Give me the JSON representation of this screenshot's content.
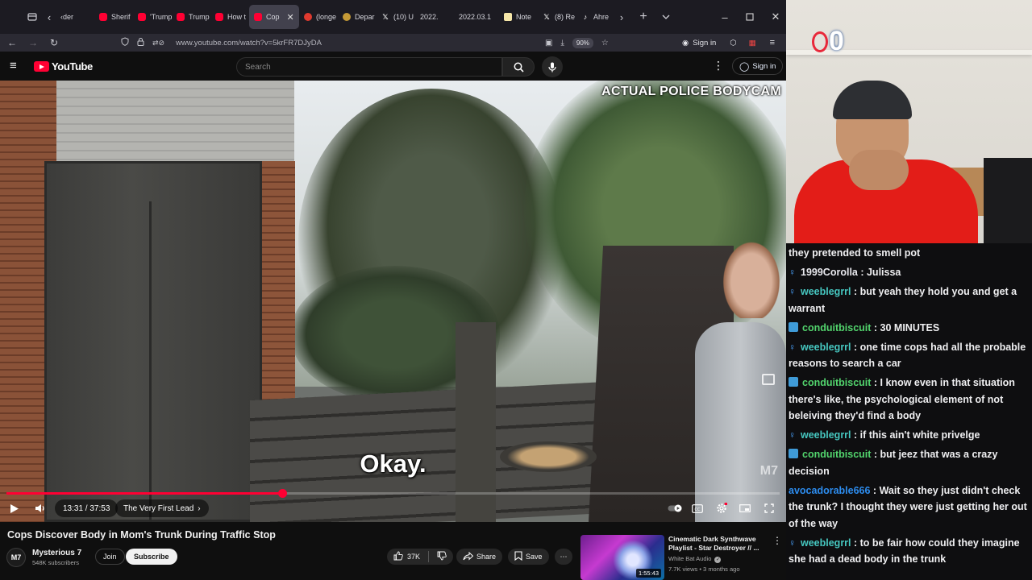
{
  "browser": {
    "tabs": [
      {
        "label": "‹der",
        "icon": "none"
      },
      {
        "label": "Sherif",
        "icon": "youtube"
      },
      {
        "label": "'Trump",
        "icon": "youtube"
      },
      {
        "label": "Trump",
        "icon": "youtube"
      },
      {
        "label": "How t",
        "icon": "youtube"
      },
      {
        "label": "Cop",
        "icon": "youtube",
        "active": true
      },
      {
        "label": "(longe",
        "icon": "red"
      },
      {
        "label": "Depar",
        "icon": "gold"
      },
      {
        "label": "(10) U",
        "icon": "x"
      },
      {
        "label": "2022.",
        "icon": "none"
      },
      {
        "label": "2022.03.1",
        "icon": "none"
      },
      {
        "label": "Note",
        "icon": "note"
      },
      {
        "label": "(8) Re",
        "icon": "x"
      },
      {
        "label": "Ahre",
        "icon": "tiktok"
      }
    ],
    "url": "www.youtube.com/watch?v=5krFR7DJyDA",
    "zoom": "90%",
    "signin_label": "Sign in"
  },
  "youtube": {
    "logo_text": "YouTube",
    "search_placeholder": "Search",
    "signin_label": "Sign in",
    "video": {
      "overlay_label": "ACTUAL POLICE BODYCAM",
      "caption": "Okay.",
      "watermark": "M7",
      "time_current": "13:31",
      "time_total": "37:53",
      "time_display": "13:31 / 37:53",
      "progress": 0.357,
      "chapter": "The Very First Lead"
    },
    "title": "Cops Discover Body in Mom's Trunk During Traffic Stop",
    "channel": {
      "name": "Mysterious 7",
      "subscribers": "548K subscribers",
      "avatar_text": "M7",
      "join_label": "Join",
      "subscribe_label": "Subscribe"
    },
    "actions": {
      "likes": "37K",
      "share_label": "Share",
      "save_label": "Save"
    },
    "recommendation": {
      "title": "Cinematic Dark Synthwave Playlist - Star Destroyer // ...",
      "channel": "White Bat Audio",
      "meta": "7.7K views • 3 months ago",
      "duration": "1:55:43"
    }
  },
  "stream": {
    "overlay_count": "0",
    "chat": [
      {
        "user": "",
        "badge": "none",
        "text": "they pretended to smell pot"
      },
      {
        "user": "1999Corolla",
        "badge": "person",
        "text": "Julissa"
      },
      {
        "user": "weeblegrrl",
        "badge": "person",
        "text": "but yeah they hold you and get a warrant"
      },
      {
        "user": "conduitbiscuit",
        "badge": "tile",
        "text": "30 MINUTES"
      },
      {
        "user": "weeblegrrl",
        "badge": "person",
        "text": "one time cops had all the probable reasons to search a car"
      },
      {
        "user": "conduitbiscuit",
        "badge": "tile",
        "text": "I know even in that situation there's like, the psychological element of not beleiving they'd find a body"
      },
      {
        "user": "weeblegrrl",
        "badge": "person",
        "text": "if this ain't white privelge"
      },
      {
        "user": "conduitbiscuit",
        "badge": "tile",
        "text": "but jeez that was a crazy decision"
      },
      {
        "user": "avocadorable666",
        "badge": "none",
        "text": "Wait so they just didn't check the trunk? I thought they were just getting her out of the way"
      },
      {
        "user": "weeblegrrl",
        "badge": "person",
        "text": "to be fair how could they imagine she had a dead body in the trunk"
      }
    ],
    "user_colors": {
      "1999Corolla": "#e9e9ee",
      "weeblegrrl": "#46c7c0",
      "conduitbiscuit": "#52d46d",
      "avocadorable666": "#2d8df0"
    }
  }
}
